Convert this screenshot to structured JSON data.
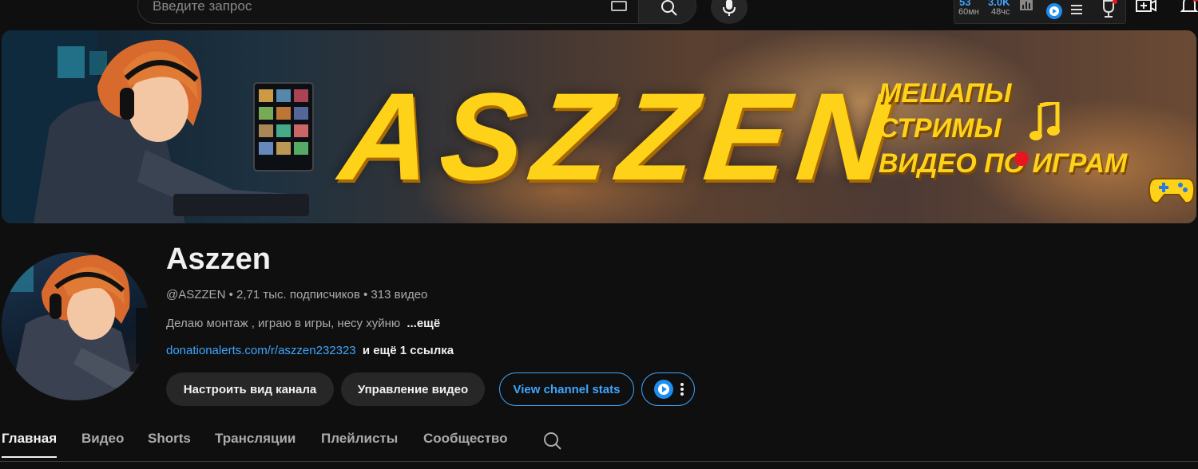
{
  "search": {
    "placeholder": "Введите запрос"
  },
  "stats_widget": {
    "value1": "53",
    "label1": "60мн",
    "value2": "3.0K",
    "label2": "48чс"
  },
  "banner": {
    "title": "ASZZEN",
    "taglines": [
      "МЕШАПЫ",
      "СТРИМЫ",
      "ВИДЕО ПО ИГРАМ"
    ]
  },
  "channel": {
    "name": "Aszzen",
    "handle": "@ASZZEN",
    "subscribers": "2,71 тыс. подписчиков",
    "videos": "313 видео",
    "description": "Делаю монтаж , играю в игры, несу хуйню",
    "description_more": "...ещё",
    "link": "donationalerts.com/r/aszzen232323",
    "link_more": "и ещё 1 ссылка"
  },
  "buttons": {
    "customize": "Настроить вид канала",
    "manage": "Управление видео",
    "stats": "View channel stats"
  },
  "tabs": [
    "Главная",
    "Видео",
    "Shorts",
    "Трансляции",
    "Плейлисты",
    "Сообщество"
  ],
  "colors": {
    "accent_blue": "#3ea6ff",
    "banner_yellow": "#ffd21a",
    "live_red": "#e81420",
    "background": "#0f0f0f"
  }
}
